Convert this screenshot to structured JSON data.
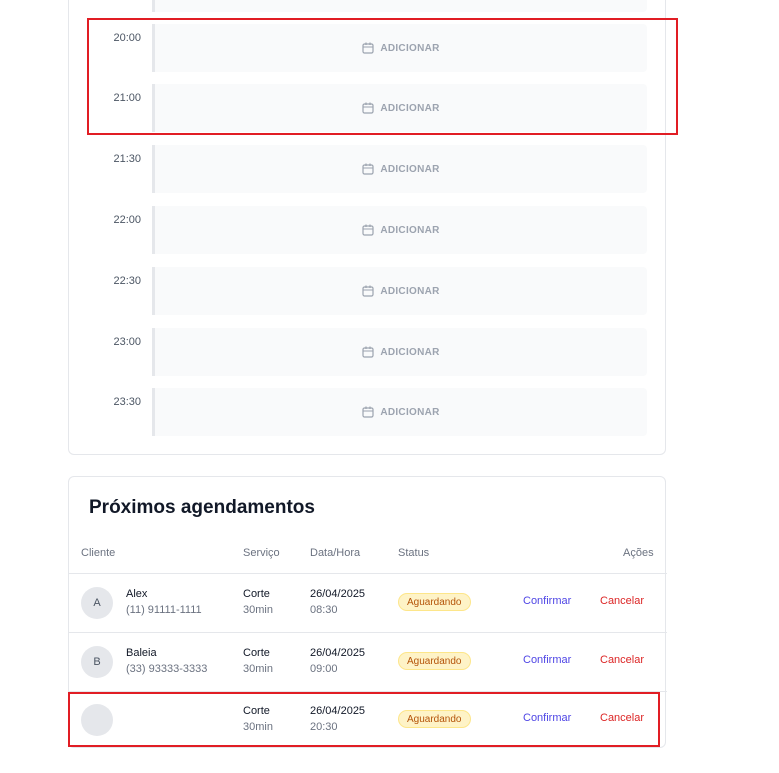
{
  "schedule": {
    "add_label": "ADICIONAR",
    "slots": [
      {
        "time": ""
      },
      {
        "time": "20:00"
      },
      {
        "time": "21:00"
      },
      {
        "time": "21:30"
      },
      {
        "time": "22:00"
      },
      {
        "time": "22:30"
      },
      {
        "time": "23:00"
      },
      {
        "time": "23:30"
      }
    ]
  },
  "appointments": {
    "title": "Próximos agendamentos",
    "headers": {
      "client": "Cliente",
      "service": "Serviço",
      "datetime": "Data/Hora",
      "status": "Status",
      "actions": "Ações"
    },
    "rows": [
      {
        "initial": "A",
        "name": "Alex",
        "phone": "(11) 91111-1111",
        "service": "Corte",
        "duration": "30min",
        "date": "26/04/2025",
        "time": "08:30",
        "status": "Aguardando",
        "confirm": "Confirmar",
        "cancel": "Cancelar"
      },
      {
        "initial": "B",
        "name": "Baleia",
        "phone": "(33) 93333-3333",
        "service": "Corte",
        "duration": "30min",
        "date": "26/04/2025",
        "time": "09:00",
        "status": "Aguardando",
        "confirm": "Confirmar",
        "cancel": "Cancelar"
      },
      {
        "initial": "",
        "name": "",
        "phone": "",
        "service": "Corte",
        "duration": "30min",
        "date": "26/04/2025",
        "time": "20:30",
        "status": "Aguardando",
        "confirm": "Confirmar",
        "cancel": "Cancelar"
      }
    ]
  },
  "colors": {
    "highlight": "#e11d24",
    "confirm": "#4f46e5",
    "cancel": "#dc2626",
    "status_bg": "#fef3c7"
  },
  "icons": {
    "slot_icon": "calendar-icon"
  }
}
